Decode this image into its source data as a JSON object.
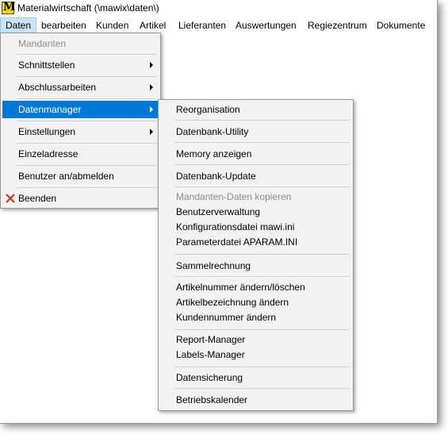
{
  "window": {
    "title": "Materialwirtschaft (\\mawix\\daten\\)",
    "icon": "app-logo-icon",
    "icon_letter": "M"
  },
  "menubar": [
    {
      "label": "Daten"
    },
    {
      "label": "bearbeiten"
    },
    {
      "label": "Kunden"
    },
    {
      "label": "Artikel"
    },
    {
      "label": "Lieferanten"
    },
    {
      "label": "Auswertungen"
    },
    {
      "label": "Regiezentrum"
    },
    {
      "label": "Dokumente"
    }
  ],
  "daten_menu": {
    "items": [
      {
        "label": "Mandanten",
        "disabled": true
      },
      {
        "label": "Schnittstellen",
        "submenu": true
      },
      {
        "label": "Abschlussarbeiten",
        "submenu": true
      },
      {
        "label": "Datenmanager",
        "submenu": true,
        "highlighted": true
      },
      {
        "label": "Einstellungen",
        "submenu": true
      },
      {
        "label": "Einzeladresse"
      },
      {
        "label": "Benutzer an/abmelden"
      },
      {
        "label": "Beenden",
        "icon": "close-x-icon"
      }
    ]
  },
  "datenmanager_menu": {
    "items": [
      {
        "label": "Reorganisation"
      },
      {
        "label": "Datenbank-Utility"
      },
      {
        "label": "Memory anzeigen"
      },
      {
        "label": "Datenbank-Update"
      },
      {
        "label": "Mandanten-Daten kopieren",
        "disabled": true
      },
      {
        "label": "Benutzerverwaltung"
      },
      {
        "label": "Konfigurationsdatei mawi.ini"
      },
      {
        "label": "Parameterdatei APARAM.INI"
      },
      {
        "label": "Sammelrechnung"
      },
      {
        "label": "Artikelnummer ändern/löschen"
      },
      {
        "label": "Artikelbezeichnung ändern"
      },
      {
        "label": "Kundennummer ändern"
      },
      {
        "label": "Report-Manager"
      },
      {
        "label": "Labels-Manager"
      },
      {
        "label": "Datensicherung"
      },
      {
        "label": "Betriebskalender"
      }
    ]
  },
  "colors": {
    "highlight": "#0078d7",
    "menubar_active": "#cce4f7",
    "menu_bg": "#f2f2f2",
    "close_icon": "#c0392b"
  }
}
